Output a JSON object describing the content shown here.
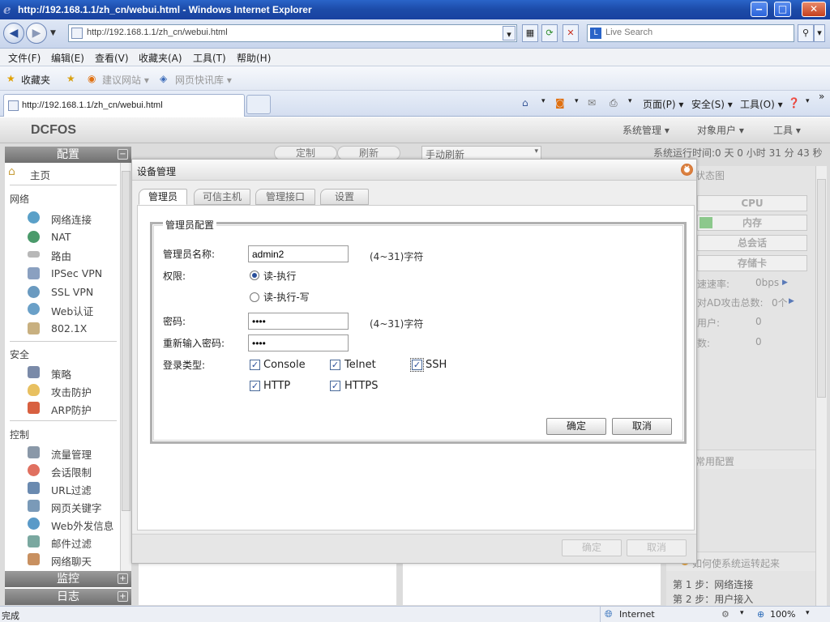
{
  "window": {
    "title": "http://192.168.1.1/zh_cn/webui.html - Windows Internet Explorer",
    "min": "‒",
    "max": "□",
    "close": "✕"
  },
  "address": {
    "url": "http://192.168.1.1/zh_cn/webui.html",
    "search_placeholder": "Live Search"
  },
  "menu": [
    "文件(F)",
    "编辑(E)",
    "查看(V)",
    "收藏夹(A)",
    "工具(T)",
    "帮助(H)"
  ],
  "favorites": {
    "label": "收藏夹",
    "suggested": "建议网站 ▾",
    "gallery": "网页快讯库 ▾"
  },
  "tab": {
    "title": "http://192.168.1.1/zh_cn/webui.html"
  },
  "commands": {
    "page": "页面(P) ▾",
    "safety": "安全(S) ▾",
    "tools": "工具(O) ▾",
    "more": "»"
  },
  "app": {
    "brand": "DCFOS",
    "top_menu": [
      "系统管理 ▾",
      "对象用户 ▾",
      "工具 ▾"
    ],
    "uptime": "系统运行时间:0 天 0 小时 31 分 43 秒",
    "toolbar": {
      "customize": "定制",
      "refresh": "刷新",
      "refresh_mode": "手动刷新"
    }
  },
  "sidebar": {
    "config_header": "配置",
    "monitor_header": "监控",
    "log_header": "日志",
    "home": "主页",
    "groups": {
      "network": "网络",
      "security": "安全",
      "control": "控制"
    },
    "network_items": [
      "网络连接",
      "NAT",
      "路由",
      "IPSec VPN",
      "SSL VPN",
      "Web认证",
      "802.1X"
    ],
    "security_items": [
      "策略",
      "攻击防护",
      "ARP防护"
    ],
    "control_items": [
      "流量管理",
      "会话限制",
      "URL过滤",
      "网页关键字",
      "Web外发信息",
      "邮件过滤",
      "网络聊天"
    ]
  },
  "right_panel": {
    "title_tail": "状态图",
    "cpu": "CPU",
    "memory": "内存",
    "sessions": "总会话",
    "storage": "存储卡",
    "rate_label": "速速率:",
    "rate_value": "0bps",
    "ad_label": "对AD攻击总数:",
    "ad_value": "0个",
    "users_label": "用户:",
    "users_value": "0",
    "count_label": "数:",
    "count_value": "0",
    "common_config": "常用配置",
    "howto_title": "如何使系统运转起来",
    "step1": "第 1 步：网络连接",
    "step2": "第 2 步：用户接入"
  },
  "dialog": {
    "title": "设备管理",
    "tabs": [
      "管理员",
      "可信主机",
      "管理接口",
      "设置"
    ],
    "fieldset_title": "管理员配置",
    "name_label": "管理员名称:",
    "name_value": "admin2",
    "name_hint": "(4~31)字符",
    "permission_label": "权限:",
    "perm_rx": "读-执行",
    "perm_rxw": "读-执行-写",
    "password_label": "密码:",
    "password_value": "••••",
    "password_hint": "(4~31)字符",
    "confirm_label": "重新输入密码:",
    "confirm_value": "••••",
    "login_type_label": "登录类型:",
    "login_types": [
      "Console",
      "Telnet",
      "SSH",
      "HTTP",
      "HTTPS"
    ],
    "ok": "确定",
    "cancel": "取消",
    "footer_ok": "确定",
    "footer_cancel": "取消",
    "check_mark": "✓"
  },
  "statusbar": {
    "status": "完成",
    "zone": "Internet",
    "zoom": "100%"
  }
}
